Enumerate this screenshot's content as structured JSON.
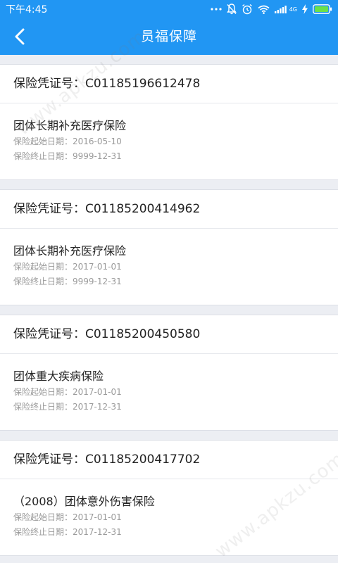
{
  "status_bar": {
    "time": "下午4:45",
    "network": "4G"
  },
  "app_bar": {
    "title": "员福保障"
  },
  "policies": [
    {
      "cert_label": "保险凭证号：",
      "cert_no": "C01185196612478",
      "plan_name": "团体长期补充医疗保险",
      "start_label": "保险起始日期：",
      "start_date": "2016-05-10",
      "end_label": "保险终止日期：",
      "end_date": "9999-12-31"
    },
    {
      "cert_label": "保险凭证号：",
      "cert_no": "C01185200414962",
      "plan_name": "团体长期补充医疗保险",
      "start_label": "保险起始日期：",
      "start_date": "2017-01-01",
      "end_label": "保险终止日期：",
      "end_date": "9999-12-31"
    },
    {
      "cert_label": "保险凭证号：",
      "cert_no": "C01185200450580",
      "plan_name": "团体重大疾病保险",
      "start_label": "保险起始日期：",
      "start_date": "2017-01-01",
      "end_label": "保险终止日期：",
      "end_date": "2017-12-31"
    },
    {
      "cert_label": "保险凭证号：",
      "cert_no": "C01185200417702",
      "plan_name": "（2008）团体意外伤害保险",
      "start_label": "保险起始日期：",
      "start_date": "2017-01-01",
      "end_label": "保险终止日期：",
      "end_date": "2017-12-31"
    }
  ],
  "watermark": {
    "text": "www.apkzu.com"
  },
  "colors": {
    "primary": "#2196f3",
    "background": "#eceef3",
    "card": "#ffffff",
    "text_primary": "#222222",
    "text_secondary": "#9a9a9a"
  }
}
